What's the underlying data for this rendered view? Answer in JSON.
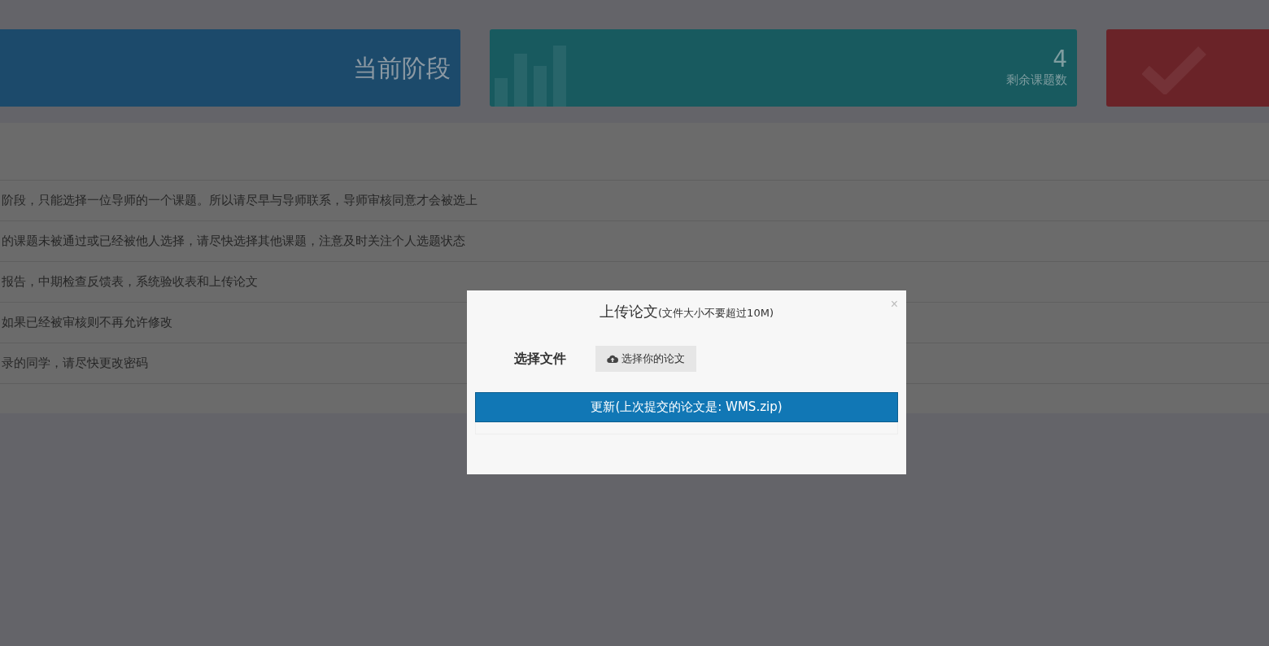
{
  "stat_cards": [
    {
      "kind": "stage",
      "color": "#1c4a6b",
      "title": "当前阶段"
    },
    {
      "kind": "count",
      "color": "#185a5f",
      "value": "4",
      "title": "剩余课题数"
    },
    {
      "kind": "done",
      "color": "#6a2328"
    }
  ],
  "notices": [
    "阶段，只能选择一位导师的一个课题。所以请尽早与导师联系，导师审核同意才会被选上",
    "的课题未被通过或已经被他人选择，请尽快选择其他课题，注意及时关注个人选题状态",
    "报告，中期检查反馈表，系统验收表和上传论文",
    "如果已经被审核则不再允许修改",
    "录的同学，请尽快更改密码"
  ],
  "modal": {
    "title": "上传论文",
    "hint": "(文件大小不要超过10M)",
    "close": "×",
    "file_label": "选择文件",
    "file_button": "选择你的论文",
    "submit_button": "更新(上次提交的论文是: WMS.zip)"
  }
}
